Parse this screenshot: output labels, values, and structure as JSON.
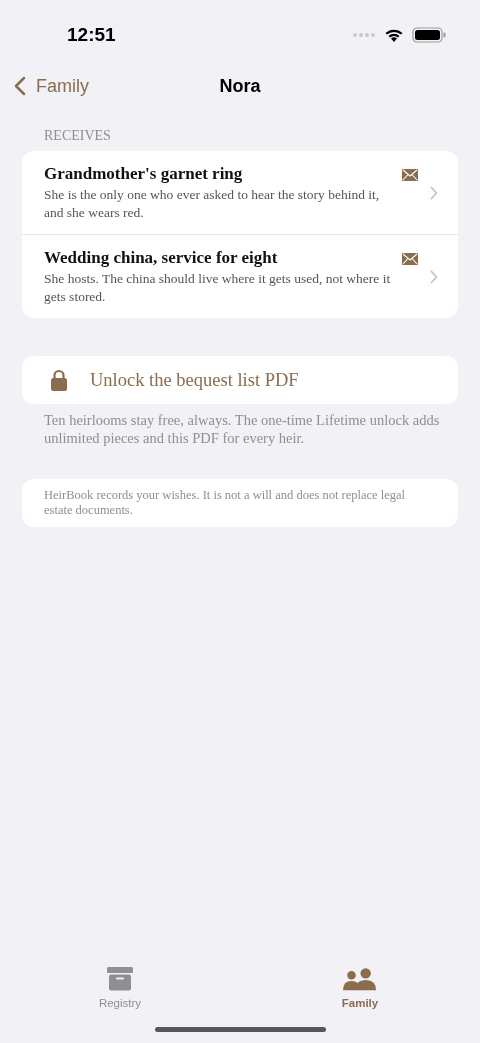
{
  "status_bar": {
    "time": "12:51"
  },
  "nav": {
    "back": "Family",
    "title": "Nora"
  },
  "section": {
    "header": "RECEIVES",
    "items": [
      {
        "title": "Grandmother's garnet ring",
        "note": "She is the only one who ever asked to hear the story behind it, and she wears red.",
        "has_letter": true
      },
      {
        "title": "Wedding china, service for eight",
        "note": "She hosts. The china should live where it gets used, not where it gets stored.",
        "has_letter": true
      }
    ]
  },
  "unlock": {
    "label": "Unlock the bequest list PDF",
    "footer": "Ten heirlooms stay free, always. The one-time Lifetime unlock adds unlimited pieces and this PDF for every heir."
  },
  "disclaimer": "HeirBook records your wishes. It is not a will and does not replace legal estate documents.",
  "tabs": [
    {
      "label": "Registry",
      "selected": false
    },
    {
      "label": "Family",
      "selected": true
    }
  ]
}
